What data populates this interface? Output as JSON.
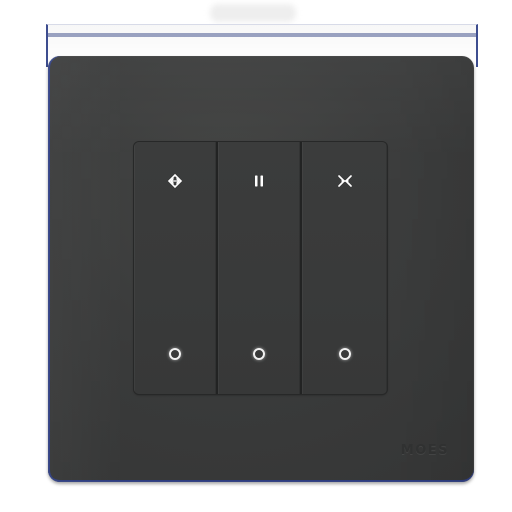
{
  "device": {
    "brand_text": "MOES",
    "plate_color": "#3c3d3d",
    "key_color": "#3a3b3b",
    "indicator_color": "#f1f1f1"
  },
  "keys": [
    {
      "icon": "open-icon"
    },
    {
      "icon": "pause-icon"
    },
    {
      "icon": "close-icon"
    }
  ]
}
